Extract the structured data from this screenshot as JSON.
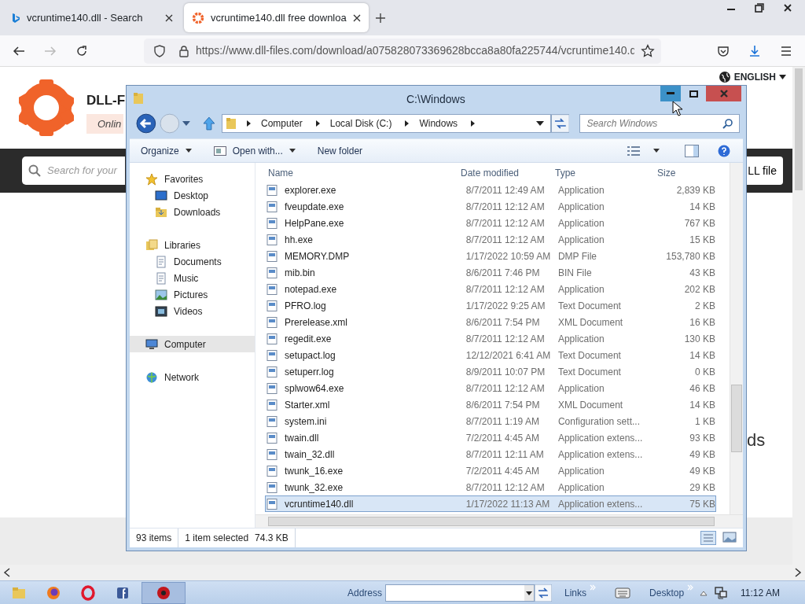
{
  "browser": {
    "tabs": [
      {
        "title": "vcruntime140.dll - Search",
        "selected": false
      },
      {
        "title": "vcruntime140.dll free downloa",
        "selected": true
      }
    ],
    "url": "https://www.dll-files.com/download/a075828073369628bcca8a80fa225744/vcruntime140.d"
  },
  "page": {
    "brand": "DLL-F",
    "tagline": "Onlin",
    "language": "ENGLISH",
    "search_placeholder": "Search for your",
    "search_button": "LL file",
    "heading_fragment": "ds"
  },
  "explorer": {
    "title": "C:\\Windows",
    "breadcrumb": [
      "Computer",
      "Local Disk (C:)",
      "Windows"
    ],
    "search_placeholder": "Search Windows",
    "commands": [
      {
        "label": "Organize",
        "dropdown": true
      },
      {
        "label": "Open with...",
        "dropdown": true
      },
      {
        "label": "New folder",
        "dropdown": false
      }
    ],
    "nav": [
      {
        "label": "Favorites",
        "kind": "favorites",
        "selected": false,
        "children": [
          {
            "label": "Desktop",
            "kind": "desktop",
            "selected": false
          },
          {
            "label": "Downloads",
            "kind": "folder",
            "selected": false
          }
        ]
      },
      {
        "label": "Libraries",
        "kind": "libraries",
        "selected": false,
        "children": [
          {
            "label": "Documents",
            "kind": "doc",
            "selected": false
          },
          {
            "label": "Music",
            "kind": "doc",
            "selected": false
          },
          {
            "label": "Pictures",
            "kind": "picture",
            "selected": false
          },
          {
            "label": "Videos",
            "kind": "video",
            "selected": false
          }
        ]
      },
      {
        "label": "Computer",
        "kind": "computer",
        "selected": true
      },
      {
        "label": "Network",
        "kind": "network",
        "selected": false
      }
    ],
    "columns": [
      "Name",
      "Date modified",
      "Type",
      "Size"
    ],
    "files": [
      {
        "name": "explorer.exe",
        "date": "8/7/2011 12:49 AM",
        "type": "Application",
        "size": "2,839 KB",
        "selected": false
      },
      {
        "name": "fveupdate.exe",
        "date": "8/7/2011 12:12 AM",
        "type": "Application",
        "size": "14 KB",
        "selected": false
      },
      {
        "name": "HelpPane.exe",
        "date": "8/7/2011 12:12 AM",
        "type": "Application",
        "size": "767 KB",
        "selected": false
      },
      {
        "name": "hh.exe",
        "date": "8/7/2011 12:12 AM",
        "type": "Application",
        "size": "15 KB",
        "selected": false
      },
      {
        "name": "MEMORY.DMP",
        "date": "1/17/2022 10:59 AM",
        "type": "DMP File",
        "size": "153,780 KB",
        "selected": false
      },
      {
        "name": "mib.bin",
        "date": "8/6/2011 7:46 PM",
        "type": "BIN File",
        "size": "43 KB",
        "selected": false
      },
      {
        "name": "notepad.exe",
        "date": "8/7/2011 12:12 AM",
        "type": "Application",
        "size": "202 KB",
        "selected": false
      },
      {
        "name": "PFRO.log",
        "date": "1/17/2022 9:25 AM",
        "type": "Text Document",
        "size": "2 KB",
        "selected": false
      },
      {
        "name": "Prerelease.xml",
        "date": "8/6/2011 7:54 PM",
        "type": "XML Document",
        "size": "16 KB",
        "selected": false
      },
      {
        "name": "regedit.exe",
        "date": "8/7/2011 12:12 AM",
        "type": "Application",
        "size": "130 KB",
        "selected": false
      },
      {
        "name": "setupact.log",
        "date": "12/12/2021 6:41 AM",
        "type": "Text Document",
        "size": "14 KB",
        "selected": false
      },
      {
        "name": "setuperr.log",
        "date": "8/9/2011 10:07 PM",
        "type": "Text Document",
        "size": "0 KB",
        "selected": false
      },
      {
        "name": "splwow64.exe",
        "date": "8/7/2011 12:12 AM",
        "type": "Application",
        "size": "46 KB",
        "selected": false
      },
      {
        "name": "Starter.xml",
        "date": "8/6/2011 7:54 PM",
        "type": "XML Document",
        "size": "14 KB",
        "selected": false
      },
      {
        "name": "system.ini",
        "date": "8/7/2011 1:19 AM",
        "type": "Configuration sett...",
        "size": "1 KB",
        "selected": false
      },
      {
        "name": "twain.dll",
        "date": "7/2/2011 4:45 AM",
        "type": "Application extens...",
        "size": "93 KB",
        "selected": false
      },
      {
        "name": "twain_32.dll",
        "date": "8/7/2011 12:11 AM",
        "type": "Application extens...",
        "size": "49 KB",
        "selected": false
      },
      {
        "name": "twunk_16.exe",
        "date": "7/2/2011 4:45 AM",
        "type": "Application",
        "size": "49 KB",
        "selected": false
      },
      {
        "name": "twunk_32.exe",
        "date": "8/7/2011 12:12 AM",
        "type": "Application",
        "size": "29 KB",
        "selected": false
      },
      {
        "name": "vcruntime140.dll",
        "date": "1/17/2022 11:13 AM",
        "type": "Application extens...",
        "size": "75 KB",
        "selected": true
      }
    ],
    "status": {
      "count": "93 items",
      "selection": "1 item selected",
      "size": "74.3 KB"
    }
  },
  "taskbar": {
    "tasks": [
      {
        "kind": "folder",
        "selected": false
      },
      {
        "kind": "firefox",
        "selected": false
      },
      {
        "kind": "opera",
        "selected": false
      },
      {
        "kind": "facebook",
        "selected": false
      },
      {
        "kind": "disc",
        "selected": true
      }
    ],
    "address_label": "Address",
    "links": "Links",
    "desktop": "Desktop",
    "clock": "11:12 AM"
  }
}
